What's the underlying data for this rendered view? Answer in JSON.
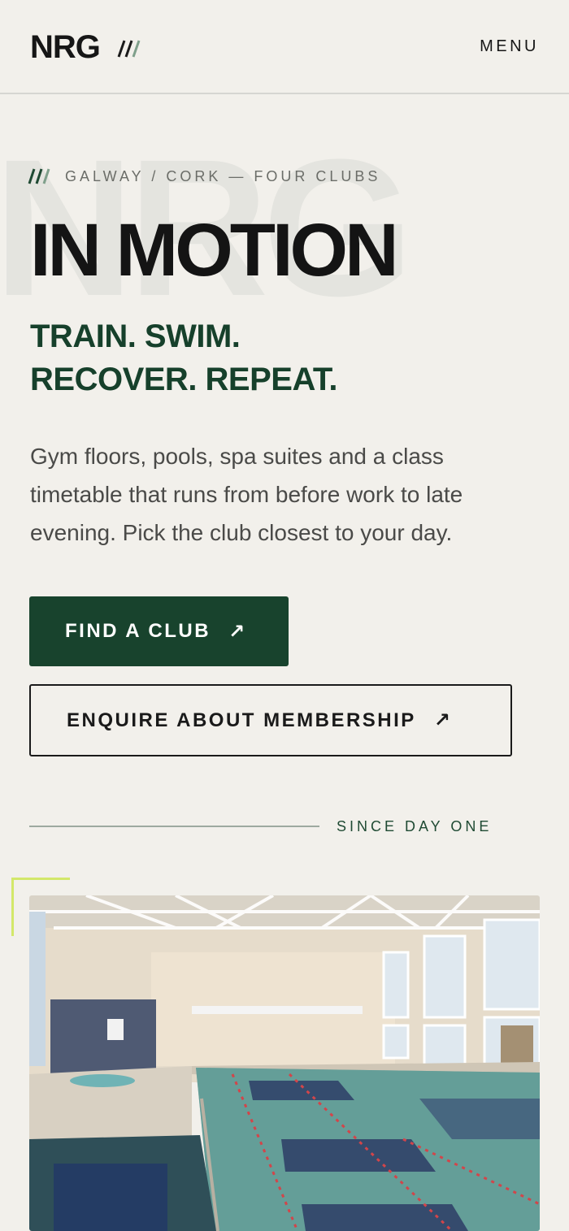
{
  "header": {
    "logo": "NRG",
    "menu_label": "MENU"
  },
  "hero": {
    "watermark": "NRG",
    "eyebrow": "GALWAY / CORK — FOUR CLUBS",
    "title": "IN MOTION",
    "tagline_line1": "TRAIN. SWIM.",
    "tagline_line2": "RECOVER. REPEAT.",
    "intro": "Gym floors, pools, spa suites and a class timetable that runs from before work to late evening. Pick the club closest to your day.",
    "primary_cta": "FIND A CLUB",
    "primary_cta_icon": "↗",
    "secondary_cta": "ENQUIRE ABOUT MEMBERSHIP",
    "secondary_cta_icon": "↗"
  },
  "section": {
    "label": "SINCE DAY ONE"
  },
  "colors": {
    "background": "#f2f0eb",
    "brand_green": "#18432d",
    "accent_lime": "#d3e86a",
    "text_dark": "#141414"
  },
  "icons": {
    "logo_mark": "triple-slash-icon",
    "eyebrow_mark": "triple-slash-icon",
    "cta_arrow": "arrow-up-right-icon"
  }
}
